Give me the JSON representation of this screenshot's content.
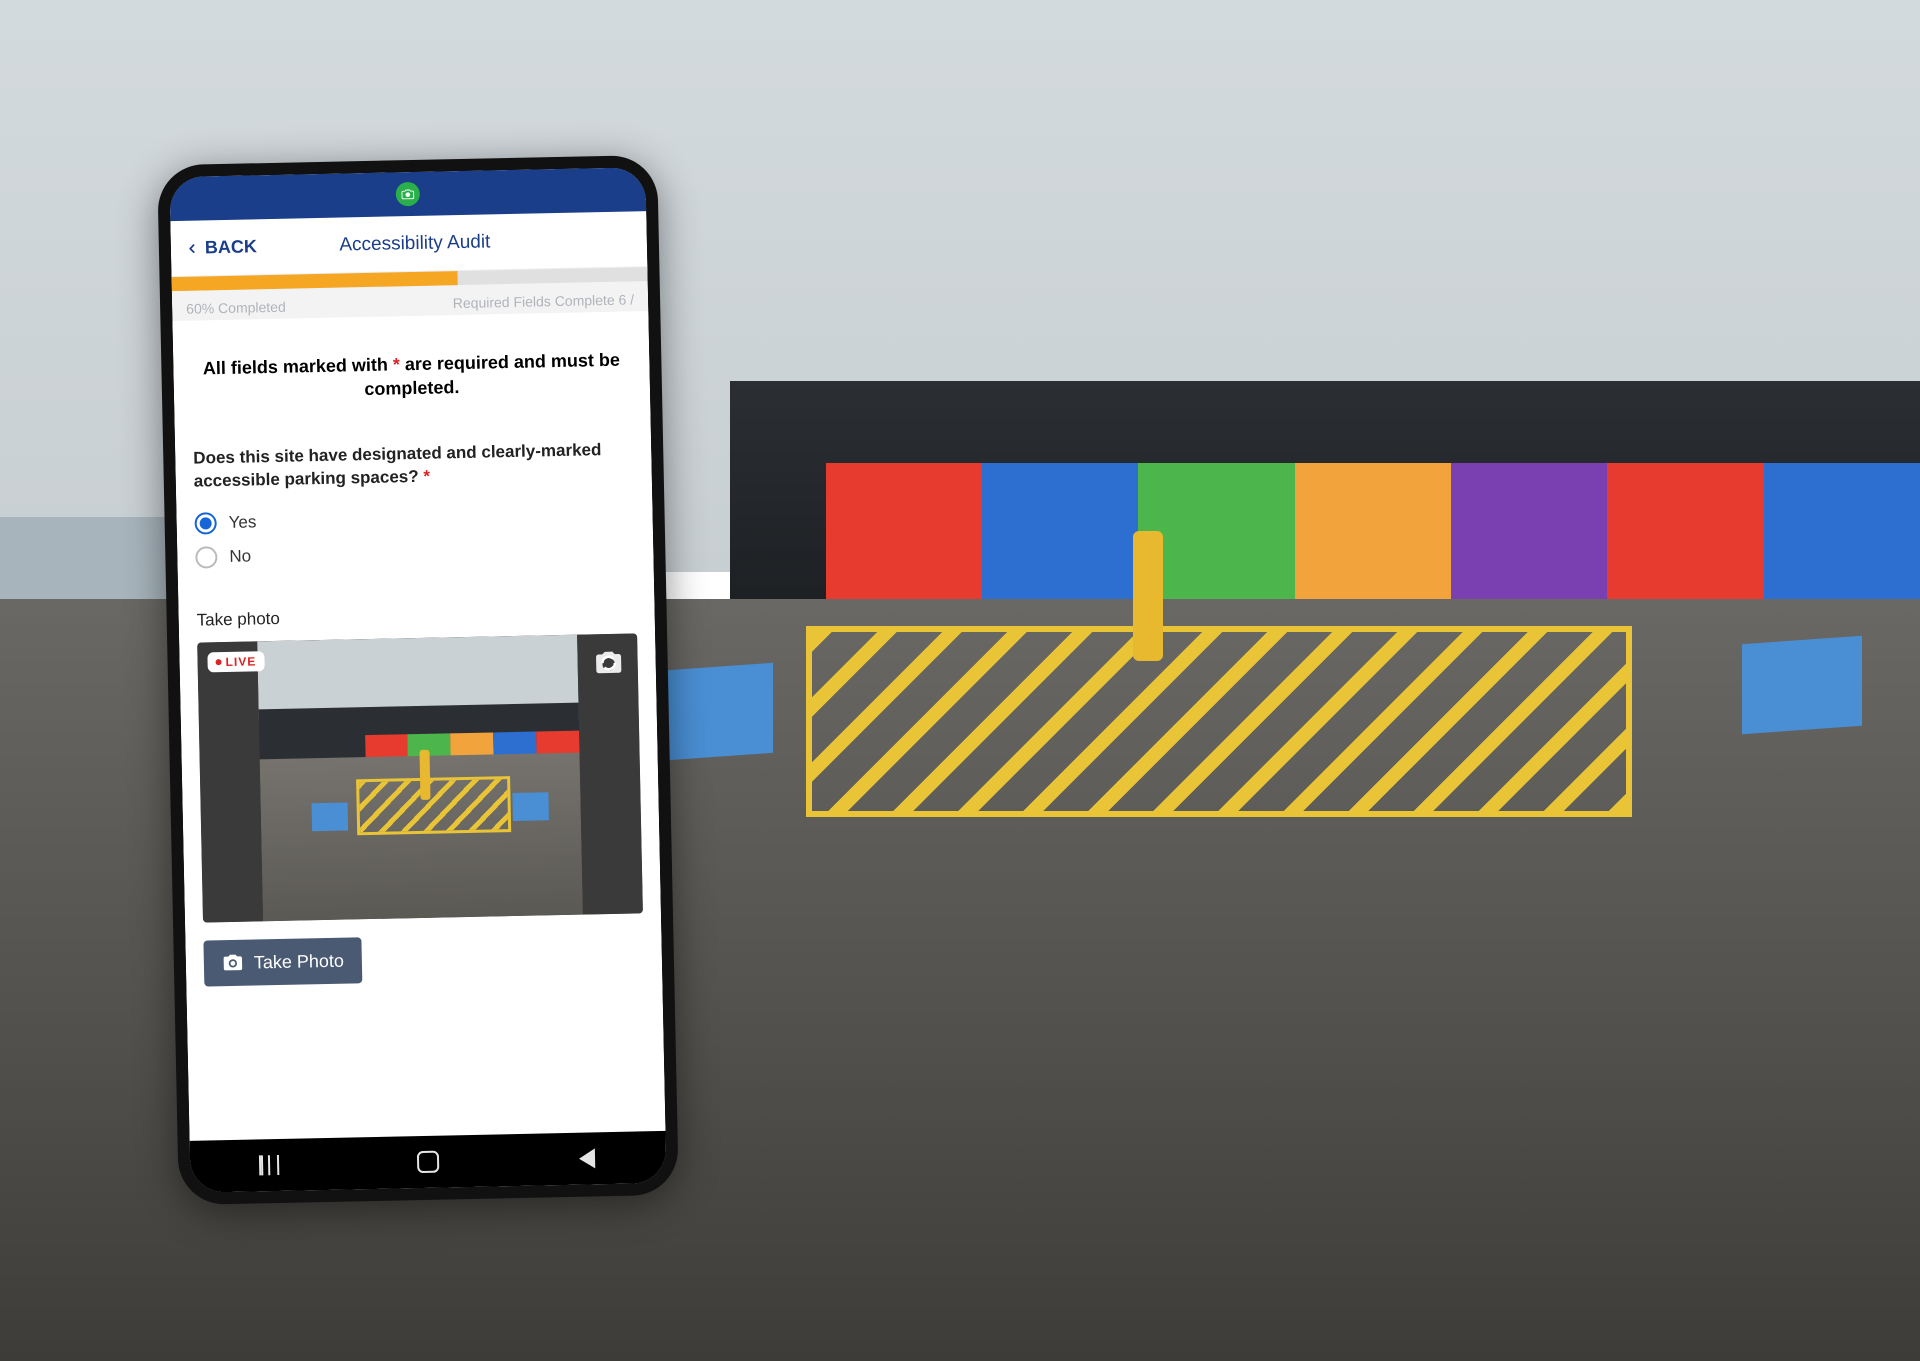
{
  "header": {
    "back_label": "BACK",
    "title": "Accessibility Audit"
  },
  "progress": {
    "percent": 60,
    "percent_label": "60%  Completed",
    "required_label": "Required Fields Complete  6 /"
  },
  "instruction": {
    "pre": "All fields marked with ",
    "star": "*",
    "post": " are required and must be completed."
  },
  "question": {
    "text": "Does this site have designated and clearly-marked accessible parking spaces? ",
    "star": "*",
    "options": [
      {
        "label": "Yes",
        "selected": true
      },
      {
        "label": "No",
        "selected": false
      }
    ]
  },
  "photo": {
    "section_label": "Take photo",
    "live_badge": "LIVE",
    "button_label": "Take Photo"
  },
  "icons": {
    "back": "chevron-left-icon",
    "status_camera": "camera-active-icon",
    "flip_camera": "flip-camera-icon",
    "camera": "camera-icon"
  },
  "colors": {
    "brand": "#1b3e8a",
    "accent_progress": "#f5a623",
    "required": "#d22",
    "radio_selected": "#1565d8",
    "button_bg": "#4a5a73"
  }
}
